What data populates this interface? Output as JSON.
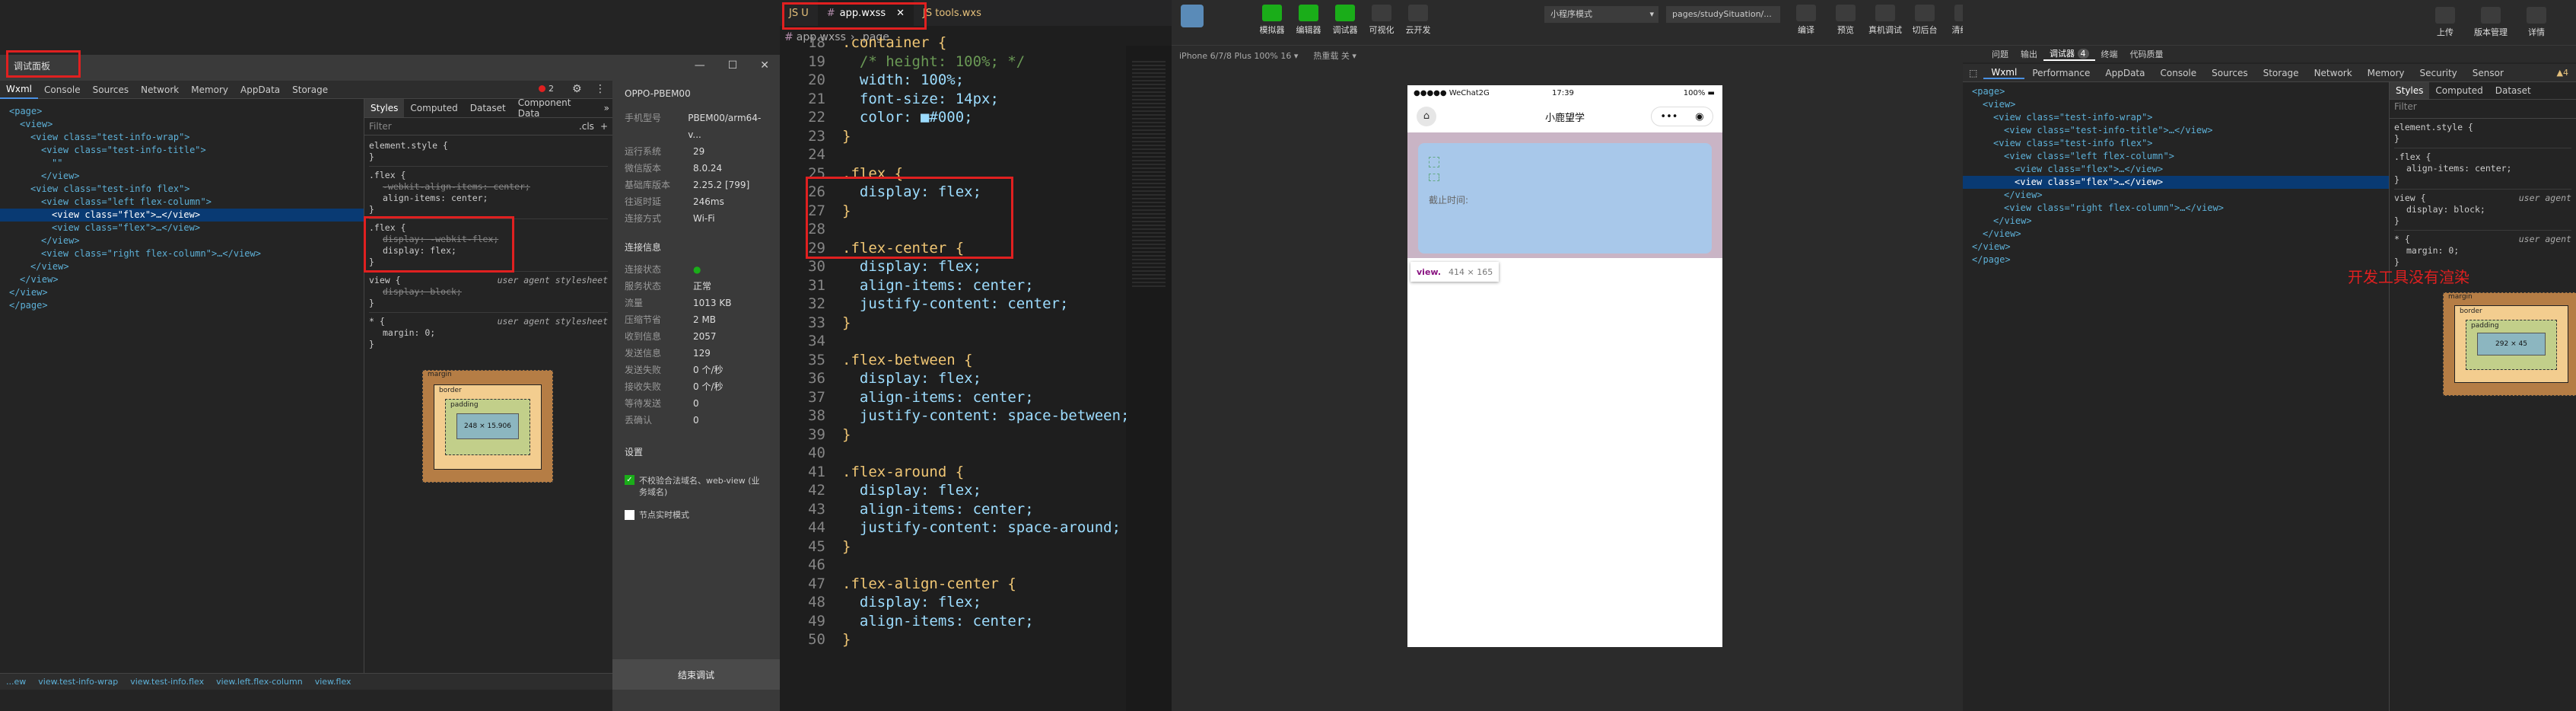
{
  "p1": {
    "title_input": "调试面板",
    "window_controls": [
      "—",
      "☐",
      "✕"
    ],
    "tabs": [
      "Wxml",
      "Console",
      "Sources",
      "Network",
      "Memory",
      "AppData",
      "Storage"
    ],
    "error_count": "2",
    "tree": [
      "<page>",
      "<view>",
      "<view class=\"test-info-wrap\">",
      "<view class=\"test-info-title\">",
      "\"\"",
      "</view>",
      "<view class=\"test-info flex\">",
      "<view class=\"left flex-column\">",
      "<view class=\"flex\">…</view>",
      "<view class=\"flex\">…</view>",
      "</view>",
      "<view class=\"right flex-column\">…</view>",
      "</view>",
      "</view>",
      "</view>",
      "</page>"
    ],
    "style_tabs": [
      "Styles",
      "Computed",
      "Dataset",
      "Component Data"
    ],
    "filter_placeholder": "Filter",
    "cls_label": ".cls",
    "rule1_selector": "element.style {",
    "rule2_selector": ".flex {",
    "rule2_p1": "-webkit-align-items: center;",
    "rule2_p2": "align-items: center;",
    "rule3_selector": ".flex {",
    "rule3_p1": "display: -webkit-flex;",
    "rule3_p2": "display: flex;",
    "rule4_selector": "view {",
    "rule4_source": "user agent stylesheet",
    "rule4_p1": "display: block;",
    "rule5_selector": "* {",
    "rule5_source": "user agent stylesheet",
    "rule5_p1": "margin: 0;",
    "close_brace": "}",
    "box_margin": "margin",
    "box_border": "border",
    "box_padding": "padding",
    "box_size": "248 × 15.906",
    "dash": "–",
    "breadcrumb": [
      "...ew",
      "view.test-info-wrap",
      "view.test-info.flex",
      "view.left.flex-column",
      "view.flex"
    ],
    "device_name": "OPPO-PBEM00",
    "device_props": [
      {
        "k": "手机型号",
        "v": "PBEM00/arm64-v..."
      },
      {
        "k": "运行系统",
        "v": "29"
      },
      {
        "k": "微信版本",
        "v": "8.0.24"
      },
      {
        "k": "基础库版本",
        "v": "2.25.2 [799]"
      },
      {
        "k": "往返时延",
        "v": "246ms"
      },
      {
        "k": "连接方式",
        "v": "Wi-Fi"
      }
    ],
    "conn_section": "连接信息",
    "conn_props": [
      {
        "k": "连接状态",
        "v": "●"
      },
      {
        "k": "服务状态",
        "v": "正常"
      },
      {
        "k": "流量",
        "v": "1013 KB"
      },
      {
        "k": "压缩节省",
        "v": "2 MB"
      },
      {
        "k": "收到信息",
        "v": "2057"
      },
      {
        "k": "发送信息",
        "v": "129"
      },
      {
        "k": "发送失败",
        "v": "0 个/秒"
      },
      {
        "k": "接收失败",
        "v": "0 个/秒"
      },
      {
        "k": "等待发送",
        "v": "0"
      },
      {
        "k": "丢确认",
        "v": "0"
      }
    ],
    "settings_section": "设置",
    "check1": "不校验合法域名、web-view (业务域名)",
    "check2": "节点实时模式",
    "end_debug": "结束调试"
  },
  "p2": {
    "tab_prev": "JS U",
    "tab_active": "app.wxss",
    "tab_next": "JS tools.wxs",
    "breadcrumb_file": "app.wxss",
    "breadcrumb_sel": ".page",
    "lines": [
      {
        "n": "18",
        "t": ".container {"
      },
      {
        "n": "19",
        "t": "  /* height: 100%; */"
      },
      {
        "n": "20",
        "t": "  width: 100%;"
      },
      {
        "n": "21",
        "t": "  font-size: 14px;"
      },
      {
        "n": "22",
        "t": "  color: ■#000;"
      },
      {
        "n": "23",
        "t": "}"
      },
      {
        "n": "24",
        "t": ""
      },
      {
        "n": "25",
        "t": ".flex {"
      },
      {
        "n": "26",
        "t": "  display: flex;"
      },
      {
        "n": "27",
        "t": "}"
      },
      {
        "n": "28",
        "t": ""
      },
      {
        "n": "29",
        "t": ".flex-center {"
      },
      {
        "n": "30",
        "t": "  display: flex;"
      },
      {
        "n": "31",
        "t": "  align-items: center;"
      },
      {
        "n": "32",
        "t": "  justify-content: center;"
      },
      {
        "n": "33",
        "t": "}"
      },
      {
        "n": "34",
        "t": ""
      },
      {
        "n": "35",
        "t": ".flex-between {"
      },
      {
        "n": "36",
        "t": "  display: flex;"
      },
      {
        "n": "37",
        "t": "  align-items: center;"
      },
      {
        "n": "38",
        "t": "  justify-content: space-between;"
      },
      {
        "n": "39",
        "t": "}"
      },
      {
        "n": "40",
        "t": ""
      },
      {
        "n": "41",
        "t": ".flex-around {"
      },
      {
        "n": "42",
        "t": "  display: flex;"
      },
      {
        "n": "43",
        "t": "  align-items: center;"
      },
      {
        "n": "44",
        "t": "  justify-content: space-around;"
      },
      {
        "n": "45",
        "t": "}"
      },
      {
        "n": "46",
        "t": ""
      },
      {
        "n": "47",
        "t": ".flex-align-center {"
      },
      {
        "n": "48",
        "t": "  display: flex;"
      },
      {
        "n": "49",
        "t": "  align-items: center;"
      },
      {
        "n": "50",
        "t": "}"
      }
    ]
  },
  "p3": {
    "toolbar": [
      "模拟器",
      "编辑器",
      "调试器",
      "可视化",
      "云开发"
    ],
    "mode": "小程序模式",
    "page_path": "pages/studySituation/...",
    "right_tools": [
      "编译",
      "预览",
      "真机调试",
      "切后台",
      "清缓存"
    ],
    "device": "iPhone 6/7/8 Plus 100% 16 ▾",
    "hot_reload": "热重载 关 ▾",
    "status_left": "●●●●● WeChat2G",
    "status_time": "17:39",
    "status_battery": "100%",
    "app_title": "小鹿望学",
    "card_text": "截止时间:",
    "tooltip_tag": "view.",
    "tooltip_size": "414 × 165"
  },
  "p4": {
    "top_actions": [
      "上传",
      "版本管理",
      "详情"
    ],
    "tabs_row1": [
      "问题",
      "输出",
      "调试器",
      "终端",
      "代码质量"
    ],
    "tabs_row1_badge": "4",
    "tabs": [
      "Wxml",
      "Performance",
      "AppData",
      "Console",
      "Sources",
      "Storage",
      "Network",
      "Memory",
      "Security",
      "Sensor"
    ],
    "warn": "▲4",
    "tree": [
      "<page>",
      "<view>",
      "<view class=\"test-info-wrap\">",
      "<view class=\"test-info-title\">…</view>",
      "<view class=\"test-info flex\">",
      "<view class=\"left flex-column\">",
      "<view class=\"flex\">…</view>",
      "<view class=\"flex\">…</view>",
      "</view>",
      "<view class=\"right flex-column\">…</view>",
      "</view>",
      "</view>",
      "</view>",
      "</page>"
    ],
    "style_tabs": [
      "Styles",
      "Computed",
      "Dataset"
    ],
    "filter_placeholder": "Filter",
    "rules": [
      {
        "sel": "element.style {",
        "src": "",
        "props": []
      },
      {
        "sel": ".flex {",
        "src": "",
        "props": [
          "align-items: center;"
        ]
      },
      {
        "sel": "view {",
        "src": "user agent",
        "props": [
          "display: block;"
        ]
      },
      {
        "sel": "* {",
        "src": "user agent",
        "props": [
          "margin: 0;"
        ]
      }
    ],
    "annotation": "开发工具没有渲染",
    "box_margin": "margin",
    "box_border": "border",
    "box_padding": "padding",
    "box_size": "292 × 45",
    "dash": "–"
  },
  "colors": {
    "accent": "#1aad19",
    "red": "#e02020",
    "selected": "#093a73",
    "phone_card": "#a8c8ea"
  }
}
